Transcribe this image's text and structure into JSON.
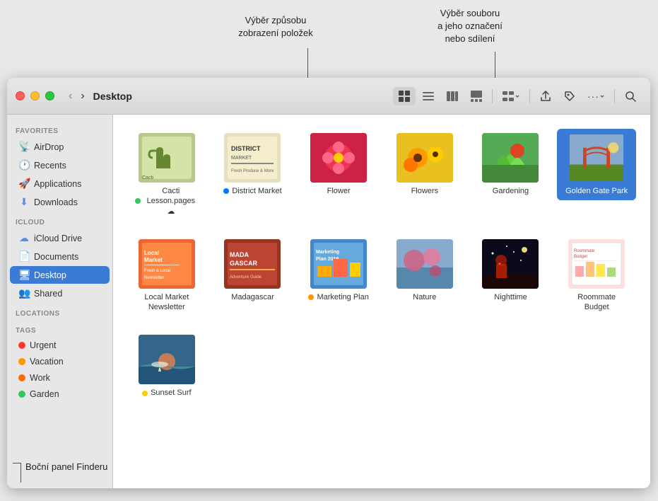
{
  "annotations": {
    "top_left_label": "Výběr způsobu\nzobrazení položek",
    "top_right_label": "Výběr souboru\na jeho označení\nnebo sdílení",
    "bottom_label": "Boční panel Finderu"
  },
  "window": {
    "title": "Desktop"
  },
  "toolbar": {
    "back": "‹",
    "forward": "›",
    "view_icon_grid": "⊞",
    "view_icon_list": "≡",
    "view_icon_columns": "⊟",
    "view_icon_gallery": "⊡",
    "group_btn": "⊞",
    "share_btn": "↑",
    "tag_btn": "◇",
    "more_btn": "···",
    "search_btn": "⌕"
  },
  "sidebar": {
    "favorites_label": "Favorites",
    "icloud_label": "iCloud",
    "locations_label": "Locations",
    "tags_label": "Tags",
    "favorites_items": [
      {
        "id": "airdrop",
        "label": "AirDrop",
        "icon": "📡"
      },
      {
        "id": "recents",
        "label": "Recents",
        "icon": "🕐"
      },
      {
        "id": "applications",
        "label": "Applications",
        "icon": "🚀"
      },
      {
        "id": "downloads",
        "label": "Downloads",
        "icon": "⬇"
      }
    ],
    "icloud_items": [
      {
        "id": "icloud-drive",
        "label": "iCloud Drive",
        "icon": "☁"
      },
      {
        "id": "documents",
        "label": "Documents",
        "icon": "📄"
      },
      {
        "id": "desktop",
        "label": "Desktop",
        "icon": "🖥",
        "active": true
      },
      {
        "id": "shared",
        "label": "Shared",
        "icon": "👥"
      }
    ],
    "tags": [
      {
        "id": "urgent",
        "label": "Urgent",
        "color": "#ff3b30"
      },
      {
        "id": "vacation",
        "label": "Vacation",
        "color": "#ff9500"
      },
      {
        "id": "work",
        "label": "Work",
        "color": "#ff6b00"
      },
      {
        "id": "garden",
        "label": "Garden",
        "color": "#34c759"
      }
    ]
  },
  "files": [
    {
      "id": "cacti",
      "label": "Cacti\nLesson.pages",
      "thumb": "cacti",
      "tag_color": "#34c759",
      "has_cloud": true
    },
    {
      "id": "district-market",
      "label": "District Market",
      "thumb": "district",
      "tag_color": "#007aff"
    },
    {
      "id": "flower",
      "label": "Flower",
      "thumb": "flower",
      "tag_color": null
    },
    {
      "id": "flowers",
      "label": "Flowers",
      "thumb": "flowers",
      "tag_color": null
    },
    {
      "id": "gardening",
      "label": "Gardening",
      "thumb": "gardening",
      "tag_color": null
    },
    {
      "id": "golden-gate",
      "label": "Golden Gate Park",
      "thumb": "golden-gate",
      "selected": true
    },
    {
      "id": "local-market",
      "label": "Local Market\nNewsletter",
      "thumb": "local-market",
      "tag_color": null
    },
    {
      "id": "madagascar",
      "label": "Madagascar",
      "thumb": "madagascar",
      "tag_color": null
    },
    {
      "id": "marketing-plan",
      "label": "Marketing Plan",
      "thumb": "marketing",
      "tag_color": "#ff9500"
    },
    {
      "id": "nature",
      "label": "Nature",
      "thumb": "nature",
      "tag_color": null
    },
    {
      "id": "nighttime",
      "label": "Nighttime",
      "thumb": "nighttime",
      "tag_color": null
    },
    {
      "id": "roommate",
      "label": "Roommate\nBudget",
      "thumb": "roommate",
      "tag_color": null
    },
    {
      "id": "sunset-surf",
      "label": "Sunset Surf",
      "thumb": "sunset",
      "tag_color": "#ffcc00"
    }
  ]
}
